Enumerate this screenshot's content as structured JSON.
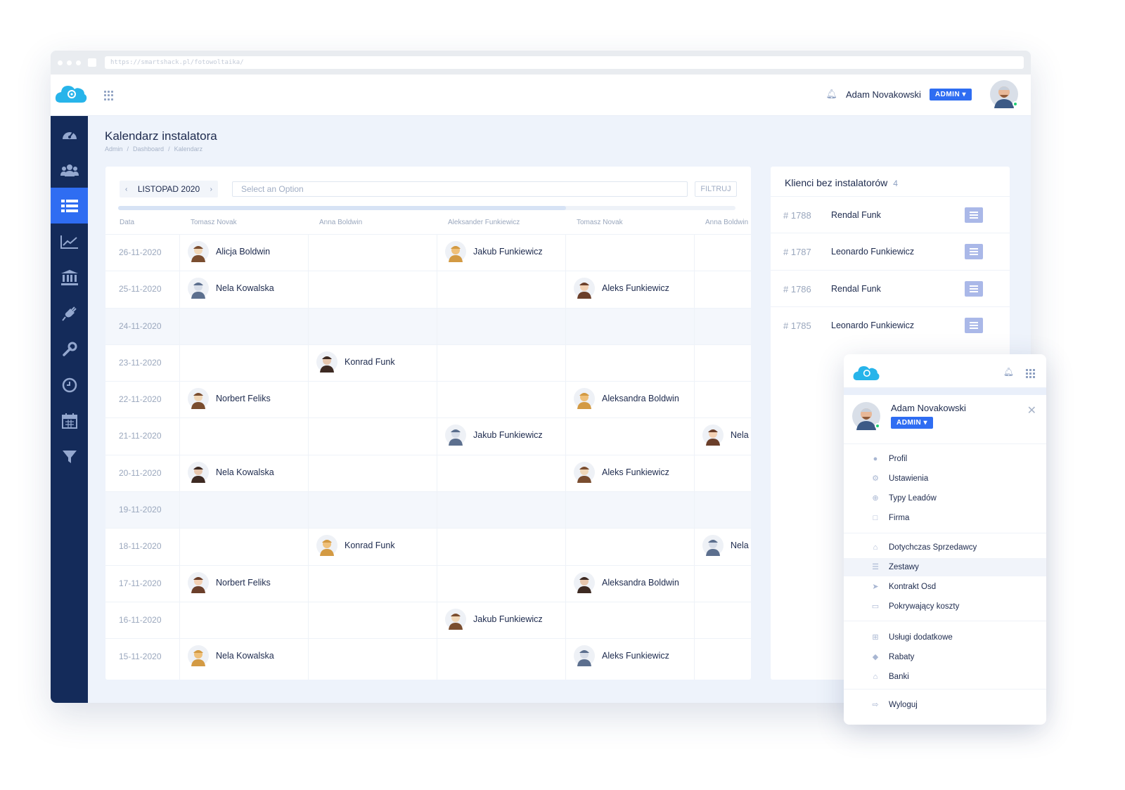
{
  "browser": {
    "url": "https://smartshack.pl/fotowoltaika/"
  },
  "header": {
    "user_name": "Adam Novakowski",
    "role_label": "ADMIN"
  },
  "sidebar": {
    "icons": [
      "dashboard-icon",
      "users-icon",
      "list-icon",
      "chart-icon",
      "bank-icon",
      "plug-icon",
      "wrench-icon",
      "clock-icon",
      "calendar-icon",
      "filter-icon"
    ],
    "active": "list-icon"
  },
  "page": {
    "title": "Kalendarz instalatora",
    "breadcrumbs": [
      "Admin",
      "/",
      "Dashboard",
      "/",
      "Kalendarz"
    ]
  },
  "calendar": {
    "month_label": "LISTOPAD 2020",
    "select_placeholder": "Select an Option",
    "filter_label": "FILTRUJ",
    "columns": [
      "Data",
      "Tomasz Novak",
      "Anna Boldwin",
      "Aleksander Funkiewicz",
      "Tomasz Novak",
      "Anna Boldwin"
    ],
    "rows": [
      {
        "date": "26-11-2020",
        "cells": [
          "Alicja Boldwin",
          "",
          "Jakub Funkiewicz",
          "",
          ""
        ]
      },
      {
        "date": "25-11-2020",
        "cells": [
          "Nela Kowalska",
          "",
          "",
          "Aleks Funkiewicz",
          ""
        ]
      },
      {
        "date": "24-11-2020",
        "cells": [
          "",
          "",
          "",
          "",
          ""
        ]
      },
      {
        "date": "23-11-2020",
        "cells": [
          "",
          "Konrad Funk",
          "",
          "",
          ""
        ]
      },
      {
        "date": "22-11-2020",
        "cells": [
          "Norbert Feliks",
          "",
          "",
          "Aleksandra Boldwin",
          ""
        ]
      },
      {
        "date": "21-11-2020",
        "cells": [
          "",
          "",
          "Jakub Funkiewicz",
          "",
          "Nela"
        ]
      },
      {
        "date": "20-11-2020",
        "cells": [
          "Nela Kowalska",
          "",
          "",
          "Aleks Funkiewicz",
          ""
        ]
      },
      {
        "date": "19-11-2020",
        "cells": [
          "",
          "",
          "",
          "",
          ""
        ]
      },
      {
        "date": "18-11-2020",
        "cells": [
          "",
          "Konrad Funk",
          "",
          "",
          "Nela"
        ]
      },
      {
        "date": "17-11-2020",
        "cells": [
          "Norbert Feliks",
          "",
          "",
          "Aleksandra Boldwin",
          ""
        ]
      },
      {
        "date": "16-11-2020",
        "cells": [
          "",
          "",
          "Jakub Funkiewicz",
          "",
          ""
        ]
      },
      {
        "date": "15-11-2020",
        "cells": [
          "Nela Kowalska",
          "",
          "",
          "Aleks Funkiewicz",
          ""
        ]
      }
    ]
  },
  "clients": {
    "title": "Klienci bez instalatorów",
    "count": "4",
    "items": [
      {
        "id": "# 1788",
        "name": "Rendal Funk"
      },
      {
        "id": "# 1787",
        "name": "Leonardo Funkiewicz"
      },
      {
        "id": "# 1786",
        "name": "Rendal Funk"
      },
      {
        "id": "# 1785",
        "name": "Leonardo Funkiewicz"
      }
    ]
  },
  "dropdown": {
    "user_name": "Adam Novakowski",
    "role_label": "ADMIN",
    "groups": [
      [
        {
          "label": "Profil",
          "icon": "user-icon"
        },
        {
          "label": "Ustawienia",
          "icon": "gears-icon"
        },
        {
          "label": "Typy Leadów",
          "icon": "plus-circle-icon"
        },
        {
          "label": "Firma",
          "icon": "clipboard-icon"
        }
      ],
      [
        {
          "label": "Dotychczas Sprzedawcy",
          "icon": "cart-icon"
        },
        {
          "label": "Zestawy",
          "icon": "list-icon",
          "highlighted": true
        },
        {
          "label": "Kontrakt Osd",
          "icon": "plane-icon"
        },
        {
          "label": "Pokrywający koszty",
          "icon": "card-icon"
        }
      ],
      [
        {
          "label": "Usługi dodatkowe",
          "icon": "plus-square-icon"
        },
        {
          "label": "Rabaty",
          "icon": "tags-icon"
        },
        {
          "label": "Banki",
          "icon": "bank-icon"
        }
      ],
      [
        {
          "label": "Wyloguj",
          "icon": "logout-icon"
        }
      ]
    ]
  }
}
